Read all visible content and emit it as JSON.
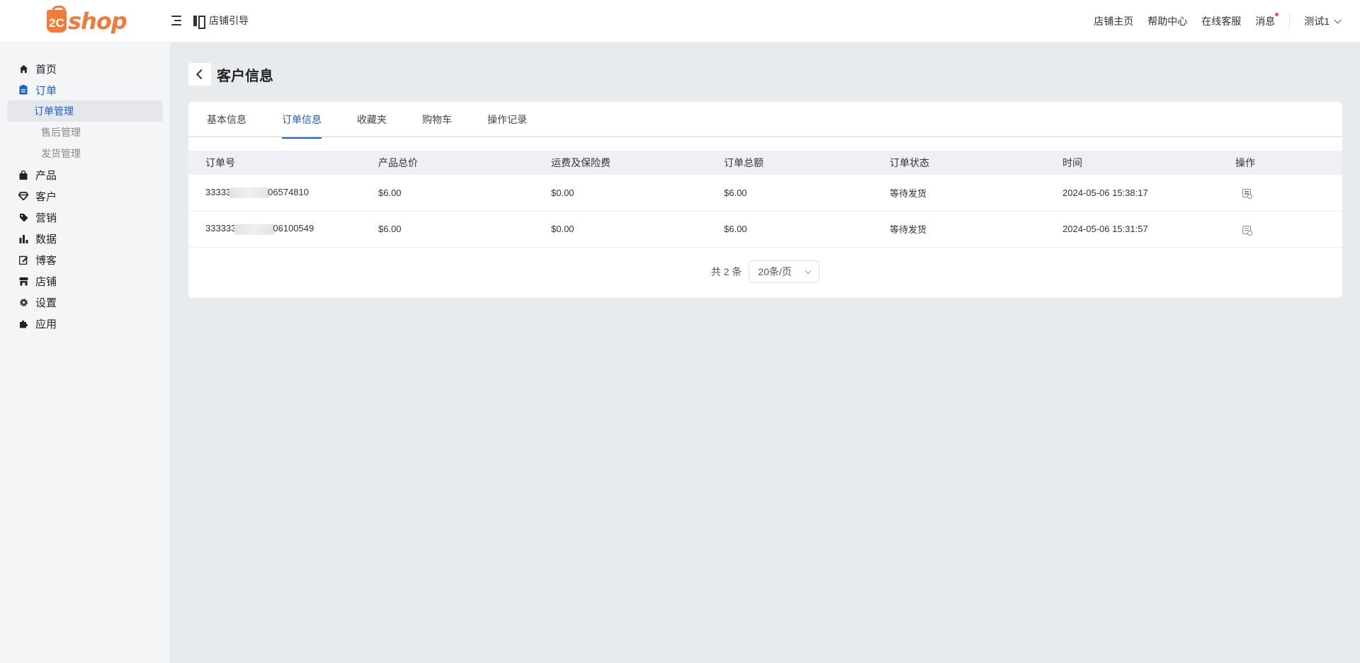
{
  "header": {
    "logo_badge": "2C",
    "logo_text": "shop",
    "guide_label": "店铺引导",
    "links": [
      "店铺主页",
      "帮助中心",
      "在线客服",
      "消息"
    ],
    "user": "测试1"
  },
  "sidebar": {
    "items": [
      {
        "label": "首页",
        "icon": "home-icon"
      },
      {
        "label": "订单",
        "icon": "clipboard-icon"
      },
      {
        "label": "产品",
        "icon": "bag-icon"
      },
      {
        "label": "客户",
        "icon": "diamond-icon"
      },
      {
        "label": "营销",
        "icon": "tag-icon"
      },
      {
        "label": "数据",
        "icon": "bar-chart-icon"
      },
      {
        "label": "博客",
        "icon": "edit-icon"
      },
      {
        "label": "店铺",
        "icon": "store-icon"
      },
      {
        "label": "设置",
        "icon": "gear-icon"
      },
      {
        "label": "应用",
        "icon": "puzzle-icon"
      }
    ],
    "order_sub": [
      "订单管理",
      "售后管理",
      "发货管理"
    ]
  },
  "main": {
    "title": "客户信息",
    "tabs": [
      "基本信息",
      "订单信息",
      "收藏夹",
      "购物车",
      "操作记录"
    ],
    "active_tab": "订单信息"
  },
  "table": {
    "headers": [
      "订单号",
      "产品总价",
      "运费及保险费",
      "订单总额",
      "订单状态",
      "时间",
      "操作"
    ],
    "rows": [
      {
        "order_prefix": "33333",
        "order_suffix": "06574810",
        "product_total": "$6.00",
        "shipping": "$0.00",
        "order_total": "$6.00",
        "status": "等待发货",
        "time": "2024-05-06 15:38:17"
      },
      {
        "order_prefix": "333333",
        "order_suffix": "06100549",
        "product_total": "$6.00",
        "shipping": "$0.00",
        "order_total": "$6.00",
        "status": "等待发货",
        "time": "2024-05-06 15:31:57"
      }
    ]
  },
  "pager": {
    "total": "共 2 条",
    "page_size": "20条/页"
  },
  "colors": {
    "accent": "#1a5fd0",
    "brand": "#f07c3c",
    "notify_dot": "#f5523c"
  }
}
